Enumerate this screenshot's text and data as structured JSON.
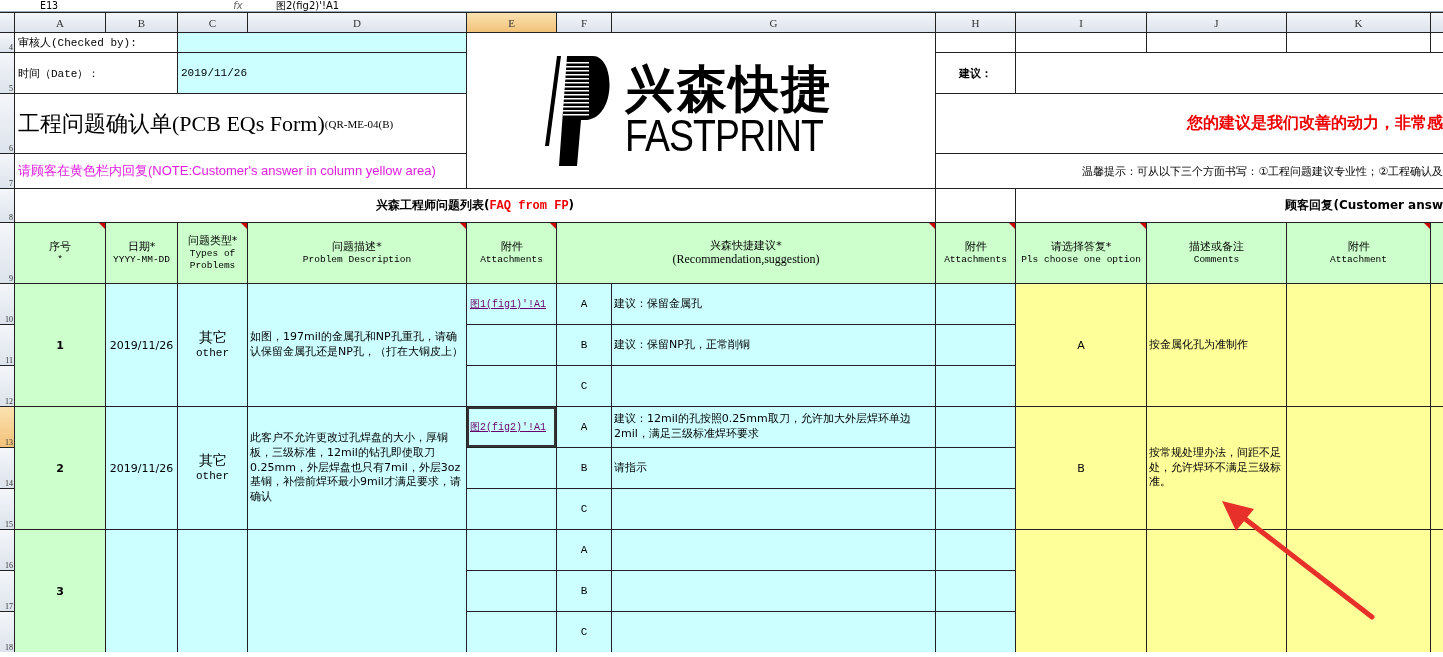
{
  "formula_bar": {
    "name_box": "E13",
    "function_label": "fx",
    "formula": "图2(fig2)'!A1"
  },
  "columns": [
    {
      "label": "A",
      "selected": false
    },
    {
      "label": "B",
      "selected": false
    },
    {
      "label": "C",
      "selected": false
    },
    {
      "label": "D",
      "selected": false
    },
    {
      "label": "E",
      "selected": true
    },
    {
      "label": "F",
      "selected": false
    },
    {
      "label": "G",
      "selected": false
    },
    {
      "label": "H",
      "selected": false
    },
    {
      "label": "I",
      "selected": false
    },
    {
      "label": "J",
      "selected": false
    },
    {
      "label": "K",
      "selected": false
    }
  ],
  "row_numbers": [
    {
      "label": "4",
      "selected": false
    },
    {
      "label": "5",
      "selected": false
    },
    {
      "label": "6",
      "selected": false
    },
    {
      "label": "7",
      "selected": false
    },
    {
      "label": "8",
      "selected": false
    },
    {
      "label": "9",
      "selected": false
    },
    {
      "label": "10",
      "selected": false
    },
    {
      "label": "11",
      "selected": false
    },
    {
      "label": "12",
      "selected": false
    },
    {
      "label": "13",
      "selected": true
    },
    {
      "label": "14",
      "selected": false
    },
    {
      "label": "15",
      "selected": false
    },
    {
      "label": "16",
      "selected": false
    },
    {
      "label": "17",
      "selected": false
    },
    {
      "label": "18",
      "selected": false
    }
  ],
  "form": {
    "checked_by_label": "审核人(Checked by):",
    "date_label": "时间（Date）：",
    "date_value": "2019/11/26",
    "title": "工程问题确认单(PCB EQs Form)",
    "title_code": "(QR-ME-04(B)",
    "note": "请顾客在黄色栏内回复(NOTE:Customer's answer in column yellow area)",
    "logo": {
      "name_zh": "兴森快捷",
      "name_en": "FASTPRINT"
    },
    "suggestion_label": "建议：",
    "thanks": "您的建议是我们改善的动力，非常感",
    "tip": "温馨提示：可从以下三个方面书写：①工程问题建议专业性；②工程确认及"
  },
  "fp_section": {
    "title": "兴森工程师问题列表(",
    "title_highlight": "FAQ from FP",
    "title_end": ")"
  },
  "customer_section": {
    "title": "顾客回复(Customer answ"
  },
  "table": {
    "columns": [
      {
        "zh": "序号",
        "en": "*",
        "comment": true
      },
      {
        "zh": "日期*",
        "en": "YYYY-MM-DD",
        "comment": false
      },
      {
        "zh": "问题类型*",
        "en": "Types of Problems",
        "comment": true
      },
      {
        "zh": "问题描述*",
        "en": "Problem Description",
        "comment": true
      },
      {
        "zh": "附件",
        "en": "Attachments",
        "comment": true
      },
      {
        "zh": "兴森快捷建议*",
        "en": "(Recommendation,suggestion)",
        "comment": true
      },
      {
        "zh": "附件",
        "en": "Attachments",
        "comment": true
      },
      {
        "zh": "请选择答复*",
        "en": "Pls choose one option",
        "comment": true
      },
      {
        "zh": "描述或备注",
        "en": "Comments",
        "comment": false
      },
      {
        "zh": "附件",
        "en": "Attachment",
        "comment": true
      }
    ],
    "issues": [
      {
        "no": "1",
        "date": "2019/11/26",
        "type_zh": "其它",
        "type_en": "other",
        "description": "如图，197mil的金属孔和NP孔重孔，请确认保留金属孔还是NP孔，（打在大铜皮上）",
        "answer": "A",
        "comment": "按金属化孔为准制作",
        "options": [
          {
            "letter": "A",
            "text": "建议：保留金属孔",
            "attachment": "图1(fig1)'!A1",
            "active": false
          },
          {
            "letter": "B",
            "text": "建议：保留NP孔，正常削铜",
            "active": false
          },
          {
            "letter": "C",
            "active": false
          }
        ]
      },
      {
        "no": "2",
        "date": "2019/11/26",
        "type_zh": "其它",
        "type_en": "other",
        "description": "此客户不允许更改过孔焊盘的大小，厚铜板，三级标准，12mil的钻孔即使取刀0.25mm，外层焊盘也只有7mil，外层3oz基铜，补偿前焊环最小9mil才满足要求，请确认",
        "answer": "B",
        "comment": "按常规处理办法，间距不足处，允许焊环不满足三级标准。",
        "options": [
          {
            "letter": "A",
            "text": "建议：12mil的孔按照0.25mm取刀，允许加大外层焊环单边2mil，满足三级标准焊环要求",
            "attachment": "图2(fig2)'!A1",
            "active": true
          },
          {
            "letter": "B",
            "text": "请指示",
            "active": false
          },
          {
            "letter": "C",
            "active": false
          }
        ]
      },
      {
        "no": "3",
        "options": [
          {
            "letter": "A",
            "active": false
          },
          {
            "letter": "B",
            "active": false
          },
          {
            "letter": "C",
            "active": false
          }
        ]
      }
    ]
  }
}
